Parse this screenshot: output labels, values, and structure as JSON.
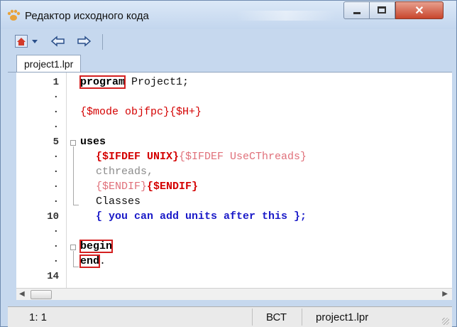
{
  "window": {
    "title": "Редактор исходного кода",
    "close_glyph": "✕"
  },
  "toolbar": {
    "icons": [
      "home-icon",
      "dropdown-arrow-icon",
      "jump-back-icon",
      "jump-forward-icon"
    ]
  },
  "tabs": [
    {
      "label": "project1.lpr"
    }
  ],
  "editor": {
    "line_numbers": [
      "1",
      "·",
      "·",
      "·",
      "5",
      "·",
      "·",
      "·",
      "·",
      "10",
      "·",
      "·",
      "·",
      "14"
    ],
    "code": {
      "l1_kw": "program",
      "l1_rest": " Project1;",
      "l3": "{$mode objfpc}{$H+}",
      "l5_kw": "uses",
      "l6_a": "{$IFDEF UNIX}",
      "l6_b": "{$IFDEF UseCThreads}",
      "l7": "cthreads,",
      "l8_a": "{$ENDIF}",
      "l8_b": "{$ENDIF}",
      "l9": "Classes",
      "l10": "{ you can add units after this };",
      "l12_kw": "begin",
      "l13_kw": "end",
      "l13_rest": "."
    }
  },
  "statusbar": {
    "position": "1: 1",
    "mode": "ВСТ",
    "file": "project1.lpr"
  },
  "colors": {
    "directive": "#d40000",
    "comment": "#1a1ac8",
    "highlight_box": "#d42020"
  }
}
